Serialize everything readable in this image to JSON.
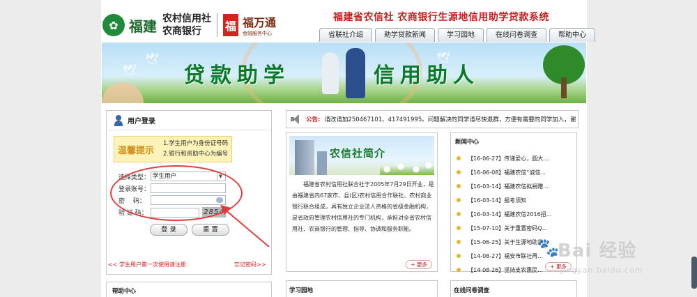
{
  "header": {
    "logo_region": "福建",
    "logo_bank_line1": "农村信用社",
    "logo_bank_line2": "农商银行",
    "logo_brand": "福万通",
    "logo_brand_sub": "金融服务中心",
    "site_title": "福建省农信社 农商银行生源地信用助学贷款系统"
  },
  "nav": {
    "tabs": [
      "省联社介绍",
      "助学贷款新闻",
      "学习园地",
      "在线问卷调查",
      "帮助中心"
    ]
  },
  "banner": {
    "slogan_left": "贷款助学",
    "slogan_right": "信用助人"
  },
  "login": {
    "title": "用户登录",
    "tips_label": "温馨提示",
    "tips_line1": "1.学生用户为身份证号码",
    "tips_line2": "2.银行和资助中心为编号",
    "type_label": "选择类型：",
    "type_value": "学生用户",
    "account_label": "登录账号：",
    "account_value": "",
    "password_label": "密　 码：",
    "password_value": "",
    "captcha_label": "验 证 码：",
    "captcha_value": "",
    "captcha_image_text": "2854",
    "login_button": "登 录",
    "reset_button": "重 置",
    "register_link": "<< 学生用户第一次使用请注册",
    "forgot_link": "忘记密码>>"
  },
  "notice": {
    "label": "公告:",
    "text": "请改请加250467101、417491995。问题解决的同学请尽快退群，方便有需要的同学加入，谢"
  },
  "about": {
    "title": "农信社简介",
    "body": "福建省农村信用社联合社于2005年7月29日开业，是由福建省内67家市、县(区)农村信用合作联社、农村商业银行联合组成，具有独立企业法人资格的省级金融机构，是省政府管理农村信用社的专门机构，承担对全省农村信用社、农商银行的管理、指导、协调和服务职能。",
    "more": "更多"
  },
  "news": {
    "title": "新闻中心",
    "items": [
      "【16-06-27】传递爱心，圆大...",
      "【16-06-08】福建农信“诚信...",
      "【16-03-14】福建农信拟捐赠...",
      "【16-03-14】报考须知",
      "【16-03-14】福建农信2016招...",
      "【15-07-10】关于重置密码Q...",
      "【15-06-25】关于生源地助学...",
      "【14-08-27】福安市联社再...",
      "【14-08-26】坚持支农惠民..."
    ],
    "more": "更多"
  },
  "lower_sections": {
    "help": "帮助中心",
    "study": "学习园地",
    "survey": "在线问卷调查"
  },
  "watermark": {
    "text": "Bai 经验",
    "url": "jingyan.baidu.com"
  }
}
